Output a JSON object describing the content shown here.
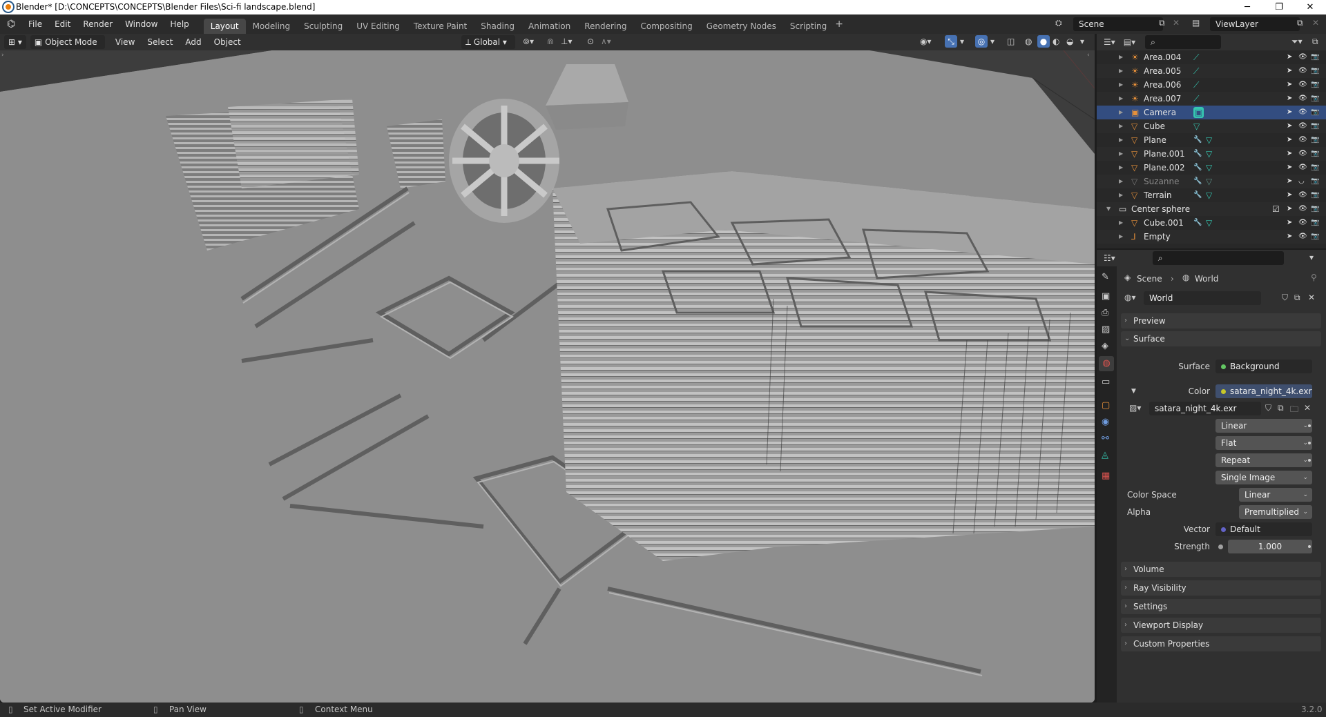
{
  "window": {
    "title": "Blender* [D:\\CONCEPTS\\CONCEPTS\\Blender Files\\Sci-fi landscape.blend]",
    "minimize": "─",
    "maximize": "❐",
    "close": "✕"
  },
  "menu": [
    "File",
    "Edit",
    "Render",
    "Window",
    "Help"
  ],
  "workspaces": [
    "Layout",
    "Modeling",
    "Sculpting",
    "UV Editing",
    "Texture Paint",
    "Shading",
    "Animation",
    "Rendering",
    "Compositing",
    "Geometry Nodes",
    "Scripting"
  ],
  "active_workspace": "Layout",
  "add_workspace": "+",
  "scene": "Scene",
  "view_layer": "ViewLayer",
  "viewport_header": {
    "mode": "Object Mode",
    "menus": [
      "View",
      "Select",
      "Add",
      "Object"
    ],
    "transform_orientation": "Global"
  },
  "outliner": {
    "rows": [
      {
        "name": "Area.004",
        "icon": "light-icon",
        "data": "light-data-icon",
        "indent": 1
      },
      {
        "name": "Area.005",
        "icon": "light-icon",
        "data": "light-data-icon",
        "indent": 1
      },
      {
        "name": "Area.006",
        "icon": "light-icon",
        "data": "light-data-icon",
        "indent": 1
      },
      {
        "name": "Area.007",
        "icon": "light-icon",
        "data": "light-data-icon",
        "indent": 1
      },
      {
        "name": "Camera",
        "icon": "camera-icon",
        "data": "camera-data-icon",
        "indent": 1,
        "selected": true
      },
      {
        "name": "Cube",
        "icon": "mesh-icon",
        "data": "mesh-data-icon",
        "indent": 1
      },
      {
        "name": "Plane",
        "icon": "mesh-icon",
        "modifier": true,
        "data": "mesh-data-icon",
        "indent": 1
      },
      {
        "name": "Plane.001",
        "icon": "mesh-icon",
        "modifier": true,
        "data": "mesh-data-icon",
        "indent": 1
      },
      {
        "name": "Plane.002",
        "icon": "mesh-icon",
        "modifier": true,
        "data": "mesh-data-icon",
        "indent": 1
      },
      {
        "name": "Suzanne",
        "icon": "mesh-icon",
        "modifier": true,
        "data": "mesh-data-icon",
        "indent": 1,
        "hidden": true
      },
      {
        "name": "Terrain",
        "icon": "mesh-icon",
        "modifier": true,
        "data": "mesh-data-icon",
        "indent": 1
      },
      {
        "name": "Center sphere",
        "icon": "collection-icon",
        "indent": 0,
        "collection": true
      },
      {
        "name": "Cube.001",
        "icon": "mesh-icon",
        "modifier": true,
        "data": "mesh-data-icon",
        "indent": 1
      },
      {
        "name": "Empty",
        "icon": "empty-icon",
        "indent": 1
      }
    ]
  },
  "properties": {
    "breadcrumb": [
      "Scene",
      "World"
    ],
    "world_name": "World",
    "panels": {
      "preview": "Preview",
      "surface": "Surface",
      "volume": "Volume",
      "ray_visibility": "Ray Visibility",
      "settings": "Settings",
      "viewport_display": "Viewport Display",
      "custom_properties": "Custom Properties"
    },
    "surface_label": "Surface",
    "surface_value": "Background",
    "color_label": "Color",
    "color_value": "satara_night_4k.exr",
    "image_name": "satara_night_4k.exr",
    "interpolation": "Linear",
    "projection": "Flat",
    "extension": "Repeat",
    "source": "Single Image",
    "color_space_label": "Color Space",
    "color_space": "Linear",
    "alpha_label": "Alpha",
    "alpha": "Premultiplied",
    "vector_label": "Vector",
    "vector": "Default",
    "strength_label": "Strength",
    "strength": "1.000"
  },
  "status": {
    "left": "Set Active Modifier",
    "middle": "Pan View",
    "right": "Context Menu",
    "version": "3.2.0"
  },
  "colors": {
    "accent": "#4772b3",
    "selection": "#334d80",
    "shader_socket_yellow": "#c7c729",
    "shader_socket_green": "#63c763",
    "vector_socket": "#6363c7",
    "light_orange": "#e8913a",
    "mesh_orange": "#e8913a",
    "data_teal": "#35c6b0"
  }
}
